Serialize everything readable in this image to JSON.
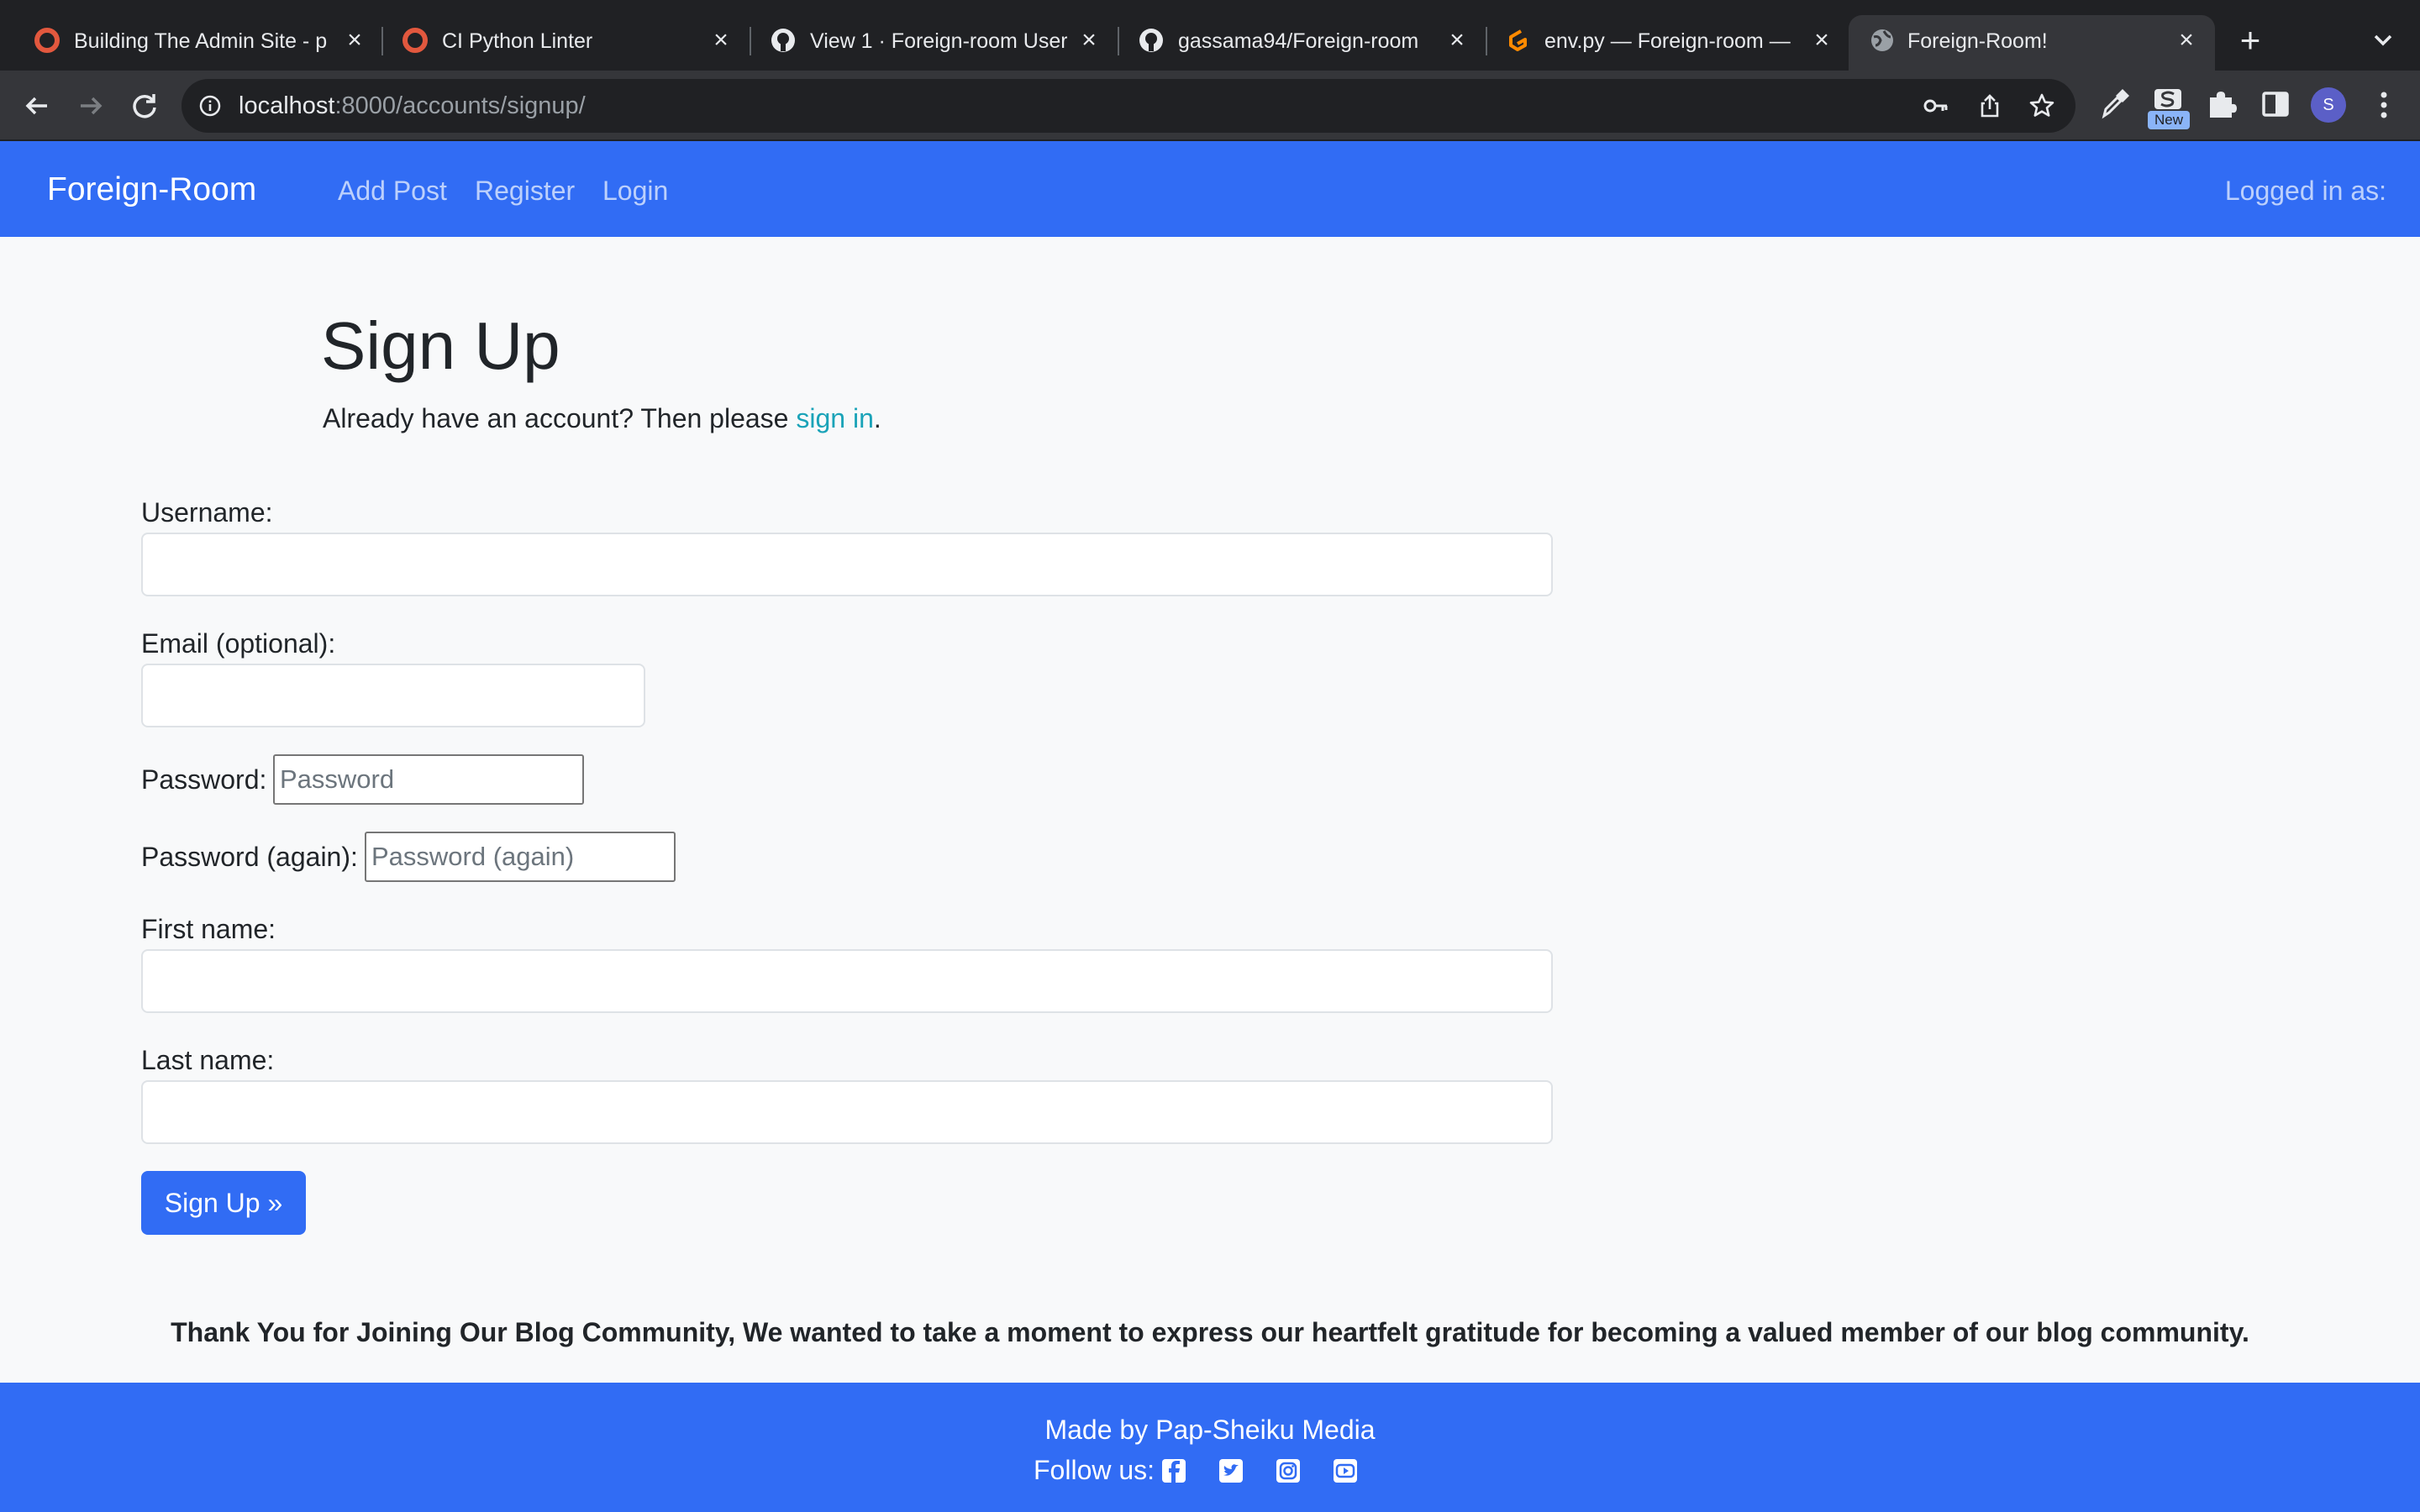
{
  "browser": {
    "tabs": [
      {
        "title": "Building The Admin Site - p",
        "icon": "codeinstitute-icon"
      },
      {
        "title": "CI Python Linter",
        "icon": "codeinstitute-icon"
      },
      {
        "title": "View 1 · Foreign-room User",
        "icon": "github-icon"
      },
      {
        "title": "gassama94/Foreign-room",
        "icon": "github-icon"
      },
      {
        "title": "env.py — Foreign-room — C",
        "icon": "gitpod-icon"
      },
      {
        "title": "Foreign-Room!",
        "icon": "globe-icon",
        "active": true
      }
    ],
    "address": {
      "host": "localhost",
      "rest": ":8000/accounts/signup/"
    },
    "extension_badge": "New",
    "profile_initial": "S"
  },
  "navbar": {
    "brand": "Foreign-Room",
    "links": [
      "Add Post",
      "Register",
      "Login"
    ],
    "logged_in": "Logged in as:"
  },
  "page": {
    "title": "Sign Up",
    "lead_prefix": "Already have an account? Then please ",
    "lead_link": "sign in",
    "lead_suffix": "."
  },
  "form": {
    "username_label": "Username:",
    "email_label": "Email (optional):",
    "password_label": "Password:",
    "password_placeholder": "Password",
    "password2_label": "Password (again):",
    "password2_placeholder": "Password (again)",
    "first_name_label": "First name:",
    "last_name_label": "Last name:",
    "submit": "Sign Up »"
  },
  "thanks": "Thank You for Joining Our Blog Community, We wanted to take a moment to express our heartfelt gratitude for becoming a valued member of our blog community.",
  "footer": {
    "made_by": "Made by Pap-Sheiku Media",
    "follow": "Follow us:",
    "social_icons": [
      "facebook-icon",
      "twitter-icon",
      "instagram-icon",
      "youtube-icon"
    ]
  },
  "colors": {
    "accent": "#316cf4",
    "link": "#1aa3b8",
    "background": "#f8f9fa"
  }
}
